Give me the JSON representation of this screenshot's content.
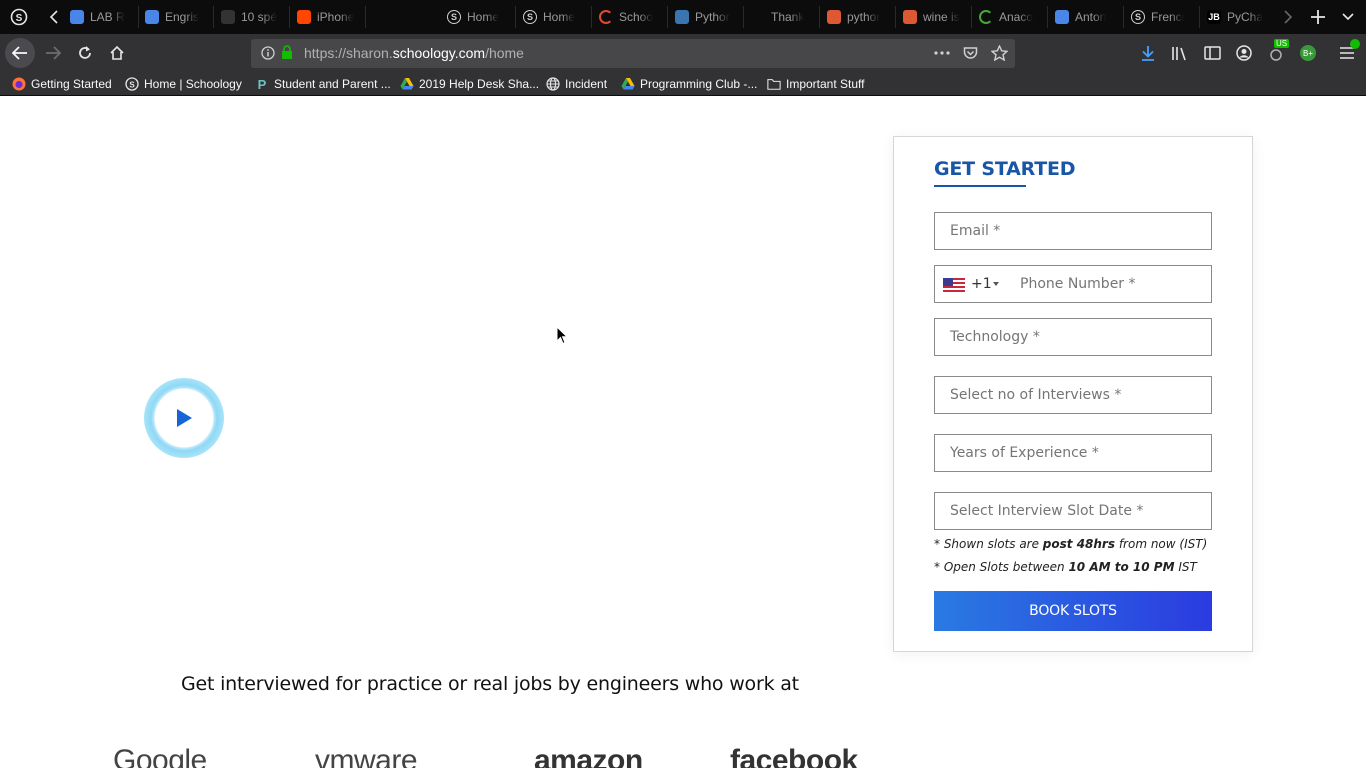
{
  "browser": {
    "tabs": [
      {
        "label": "LAB R",
        "icon": "google-docs-icon"
      },
      {
        "label": "Engris",
        "icon": "google-docs-icon"
      },
      {
        "label": "10 spé",
        "icon": "cfl-icon"
      },
      {
        "label": "iPhone",
        "icon": "reddit-icon"
      },
      {
        "label": "Home",
        "icon": "schoology-icon"
      },
      {
        "label": "Home",
        "icon": "schoology-icon"
      },
      {
        "label": "Schoo",
        "icon": "loading-icon"
      },
      {
        "label": "Pythor",
        "icon": "python-icon"
      },
      {
        "label": "Thank",
        "icon": "blank-icon"
      },
      {
        "label": "pythor",
        "icon": "duckduckgo-icon"
      },
      {
        "label": "wine is",
        "icon": "duckduckgo-icon"
      },
      {
        "label": "Anaco",
        "icon": "anaconda-icon"
      },
      {
        "label": "Anton",
        "icon": "google-docs-icon"
      },
      {
        "label": "Frenci",
        "icon": "schoology-icon"
      },
      {
        "label": "PyCha",
        "icon": "jetbrains-icon",
        "fav_text": "JB"
      }
    ],
    "url": {
      "prefix": "https://sharon.",
      "domain": "schoology.com",
      "path": "/home"
    },
    "bookmarks": [
      {
        "label": "Getting Started",
        "icon": "firefox-icon"
      },
      {
        "label": "Home | Schoology",
        "icon": "schoology-icon"
      },
      {
        "label": "Student and Parent ...",
        "icon": "powerschool-icon"
      },
      {
        "label": "2019 Help Desk Sha...",
        "icon": "google-drive-icon"
      },
      {
        "label": "Incident",
        "icon": "globe-icon"
      },
      {
        "label": "Programming Club -...",
        "icon": "google-drive-icon"
      },
      {
        "label": "Important Stuff",
        "icon": "folder-icon"
      }
    ],
    "extension_badges": {
      "vpn": "US",
      "ext": "B+"
    }
  },
  "page": {
    "tagline": "Get interviewed for practice or real jobs by engineers who work at",
    "company_logos": [
      "Google",
      "vmware",
      "amazon",
      "facebook"
    ],
    "form": {
      "title": "GET STARTED",
      "email_placeholder": "Email *",
      "phone_code": "+1",
      "phone_placeholder": "Phone Number *",
      "technology_placeholder": "Technology *",
      "interviews_placeholder": "Select no of Interviews *",
      "experience_placeholder": "Years of Experience *",
      "slot_date_placeholder": "Select Interview Slot Date *",
      "note1_pre": "* Shown slots are ",
      "note1_bold": "post 48hrs",
      "note1_post": " from now (IST)",
      "note2_pre": "* Open Slots between ",
      "note2_bold": "10 AM to 10 PM",
      "note2_post": " IST",
      "submit_label": "BOOK SLOTS"
    }
  },
  "colors": {
    "brand_blue": "#1a56a8",
    "button_start": "#2a7ae2",
    "button_end": "#2b3be0"
  }
}
